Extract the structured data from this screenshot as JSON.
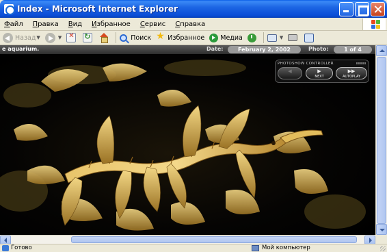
{
  "window": {
    "title": "Index - Microsoft Internet Explorer",
    "buttons": [
      "minimize",
      "maximize",
      "close"
    ]
  },
  "menu": {
    "items": [
      "Файл",
      "Правка",
      "Вид",
      "Избранное",
      "Сервис",
      "Справка"
    ]
  },
  "toolbar": {
    "back_label": "Назад",
    "search_label": "Поиск",
    "favorites_label": "Избранное",
    "media_label": "Медиа"
  },
  "page": {
    "caption": "e aquarium.",
    "date_label": "Date:",
    "date_value": "February 2, 2002",
    "photo_label": "Photo:",
    "photo_value": "1 of 4",
    "controller": {
      "title": "PHOTOSHOW CONTROLLER",
      "prev_label": "",
      "next_label": "NEXT",
      "autoplay_label": "AUTOPLAY"
    },
    "image_subject": "leafy sea dragon"
  },
  "status": {
    "text": "Готово",
    "zone": "Мой компьютер"
  },
  "colors": {
    "titlebar": "#0a4cd6",
    "chrome": "#ece9d8",
    "info_bar": "#3a3a3a",
    "pill": "#9a9a9a"
  },
  "icons": [
    "ie-logo-icon",
    "minimize-icon",
    "maximize-icon",
    "close-icon",
    "windows-logo-icon",
    "back-arrow-icon",
    "forward-arrow-icon",
    "stop-icon",
    "refresh-icon",
    "home-icon",
    "search-icon",
    "favorites-star-icon",
    "media-icon",
    "history-icon",
    "mail-icon",
    "print-icon",
    "edit-icon",
    "computer-icon",
    "done-page-icon"
  ]
}
